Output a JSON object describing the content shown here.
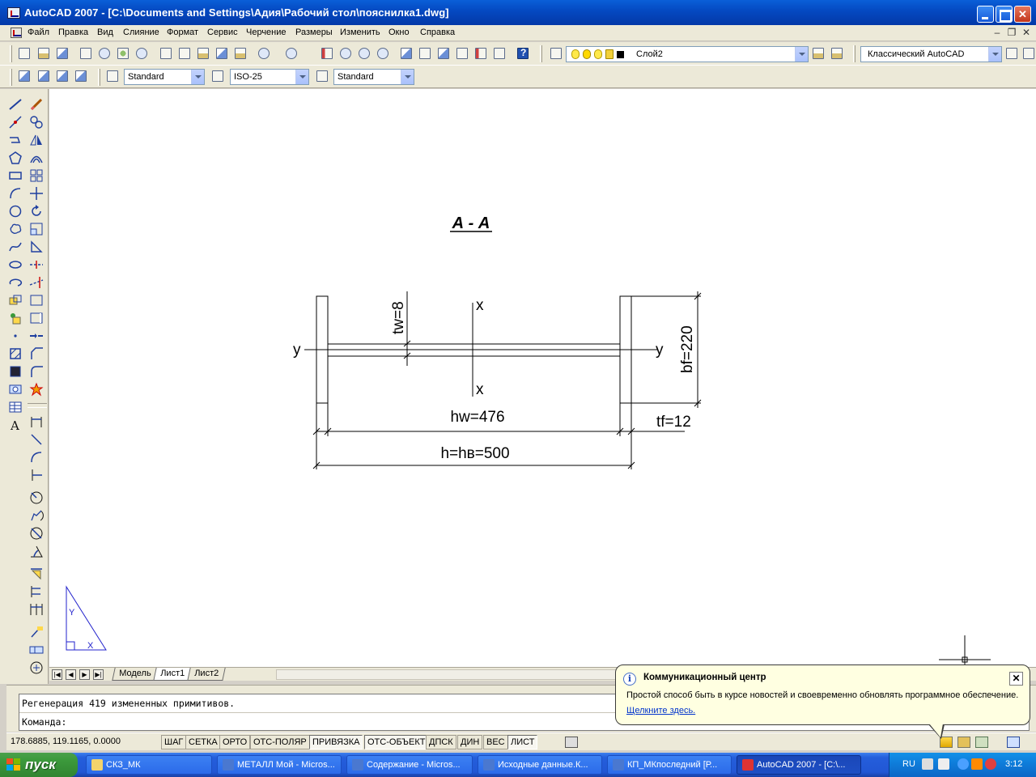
{
  "window": {
    "title": "AutoCAD 2007 - [C:\\Documents and Settings\\Адия\\Рабочий стол\\пояснилка1.dwg]",
    "minimize": "_",
    "maximize": "□",
    "close": "✕"
  },
  "menu": {
    "items": [
      "Файл",
      "Правка",
      "Вид",
      "Слияние",
      "Формат",
      "Сервис",
      "Черчение",
      "Размеры",
      "Изменить",
      "Окно",
      "Справка"
    ],
    "doc_minimize": "–",
    "doc_restore": "❐",
    "doc_close": "✕"
  },
  "toolbar": {
    "layer_combo": "Слой2",
    "workspace_combo": "Классический AutoCAD",
    "text_style": "Standard",
    "dim_style": "ISO-25",
    "table_style": "Standard"
  },
  "drawing": {
    "section_title": "А - А",
    "labels": {
      "tw": "tw=8",
      "x_top": "x",
      "x_bottom": "x",
      "y_left": "y",
      "y_right": "y",
      "bf": "bf=220",
      "hw": "hw=476",
      "tf": "tf=12",
      "h": "h=hв=500"
    },
    "ucs": {
      "x": "X",
      "y": "Y"
    }
  },
  "layout_tabs": {
    "tabs": [
      "Модель",
      "Лист1",
      "Лист2"
    ],
    "active": "Лист1"
  },
  "command": {
    "history": "Регенерация 419 измененных примитивов.",
    "prompt": "Команда:"
  },
  "status": {
    "coords": "178.6885, 119.1165, 0.0000",
    "buttons": [
      {
        "label": "ШАГ",
        "on": false
      },
      {
        "label": "СЕТКА",
        "on": false
      },
      {
        "label": "ОРТО",
        "on": false
      },
      {
        "label": "ОТС-ПОЛЯР",
        "on": false
      },
      {
        "label": "ПРИВЯЗКА",
        "on": true
      },
      {
        "label": "ОТС-ОБЪЕКТ",
        "on": true
      },
      {
        "label": "ДПСК",
        "on": false
      },
      {
        "label": "ДИН",
        "on": false
      },
      {
        "label": "ВЕС",
        "on": false
      },
      {
        "label": "ЛИСТ",
        "on": true
      }
    ]
  },
  "balloon": {
    "title": "Коммуникационный центр",
    "text": "Простой способ быть в курсе новостей и своевременно обновлять программное обеспечение.",
    "link": "Щелкните здесь.",
    "info": "i",
    "close": "✕"
  },
  "taskbar": {
    "start": "пуск",
    "tasks": [
      {
        "label": "СКЗ_МК",
        "icon_color": "#f3d36b",
        "active": false
      },
      {
        "label": "МЕТАЛЛ Мой - Micros...",
        "icon_color": "#4a78d0",
        "active": false
      },
      {
        "label": "Содержание - Micros...",
        "icon_color": "#4a78d0",
        "active": false
      },
      {
        "label": "Исходные данные.К...",
        "icon_color": "#4a78d0",
        "active": false
      },
      {
        "label": "КП_МКпоследний [Р...",
        "icon_color": "#4a78d0",
        "active": false
      },
      {
        "label": "AutoCAD 2007 - [C:\\...",
        "icon_color": "#d33",
        "active": true
      }
    ],
    "lang": "RU",
    "clock": "3:12"
  }
}
